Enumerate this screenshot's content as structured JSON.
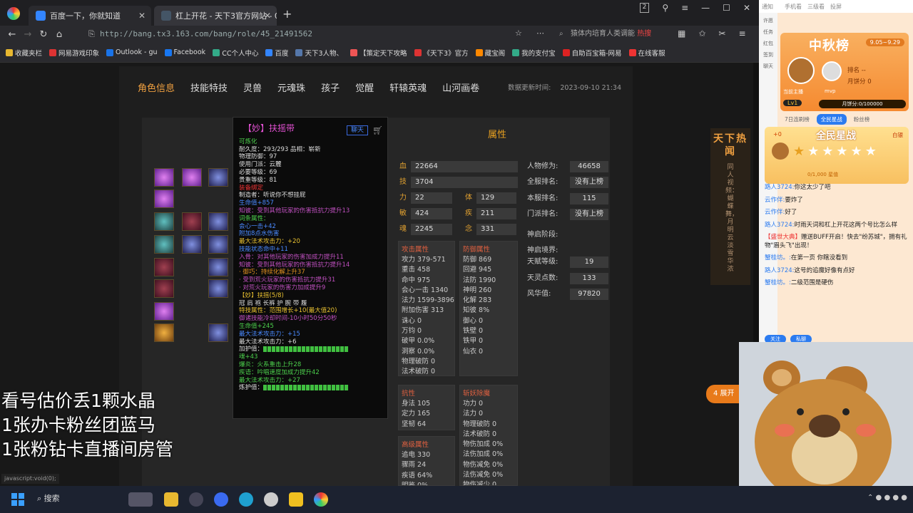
{
  "browser": {
    "tab1": "百度一下，你就知道",
    "tab2": "杠上开花 - 天下3官方网站 - 0",
    "url": "http://bang.tx3.163.com/bang/role/45_21491562",
    "search": "猿体内培育人类调能",
    "search_hot": "热搜",
    "badge_count": "2"
  },
  "bookmarks": [
    "收藏夹栏",
    "网易游戏印象",
    "Outlook - gu",
    "Facebook",
    "CC个人中心",
    "百度",
    "天下3人物、",
    "【策定天下攻略",
    "《天下3》官方",
    "藏宝阁",
    "我的支付宝",
    "自助百宝箱-网易",
    "在线客服"
  ],
  "game": {
    "tabs": [
      "角色信息",
      "技能特技",
      "灵兽",
      "元魂珠",
      "孩子",
      "觉醒",
      "轩辕英魂",
      "山河画卷"
    ],
    "active_tab": 0,
    "updated_label": "数据更新时间:",
    "updated_time": "2023-09-10 21:34",
    "attr_title": "属性",
    "stats_left": [
      {
        "k": "血",
        "v": "22664"
      },
      {
        "k": "技",
        "v": "3704"
      }
    ],
    "stats_pairs": [
      {
        "k1": "力",
        "v1": "22",
        "k2": "体",
        "v2": "129"
      },
      {
        "k1": "敏",
        "v1": "424",
        "k2": "疾",
        "v2": "211"
      },
      {
        "k1": "魂",
        "v1": "2245",
        "k2": "念",
        "v2": "331"
      }
    ],
    "stats_right": [
      {
        "k": "人物修为:",
        "v": "46658"
      },
      {
        "k": "全服排名:",
        "v": "没有上榜"
      },
      {
        "k": "本服排名:",
        "v": "115"
      },
      {
        "k": "门派排名:",
        "v": "没有上榜"
      },
      {
        "k": "神启阶段:",
        "v": ""
      },
      {
        "k": "神启境界:",
        "v": ""
      },
      {
        "k": "天赋等级:",
        "v": "19"
      },
      {
        "k": "天灵点数:",
        "v": "133"
      },
      {
        "k": "风华值:",
        "v": "97820"
      }
    ],
    "attack": {
      "title": "攻击属性",
      "rows": [
        "攻力 379-571",
        "重击 458",
        "命中 975",
        "会心一击 1340",
        "法力 1599-3896",
        "附加伤害 313",
        "诛心 0",
        "万钧 0",
        "破甲 0.0%",
        "洞察 0.0%",
        "物理破防 0",
        "法术破防 0"
      ]
    },
    "defense": {
      "title": "防御属性",
      "rows": [
        "防御 869",
        "回避 945",
        "法防 1990",
        "神明 260",
        "化解 283",
        "知彼 8%",
        "御心 0",
        "铁壁 0",
        "铁甲 0",
        "仙衣 0"
      ]
    },
    "resist": {
      "title": "抗性",
      "rows": [
        "身法 105",
        "定力 165",
        "坚韧 64"
      ]
    },
    "adv": {
      "title": "高级属性",
      "rows": [
        "追电 330",
        "骤雨 24",
        "疾语 64%",
        "明鉴 0%"
      ]
    },
    "special": {
      "title": "斩妖除魔",
      "rows": [
        "功力 0",
        "法力 0",
        "物理破防 0",
        "法术破防 0",
        "物伤加成 0%",
        "法伤加成 0%",
        "物伤减免 0%",
        "法伤减免 0%",
        "物伤减少 0"
      ]
    }
  },
  "tooltip": {
    "title": "【妙】扶摇带",
    "button": "聊天",
    "lines": [
      {
        "c": "g",
        "t": "可炼化"
      },
      {
        "c": "w",
        "t": "耐久度：293/293        品相：崭新"
      },
      {
        "c": "w",
        "t": "物理防御：97"
      },
      {
        "c": "w",
        "t": "使用门派：云麓"
      },
      {
        "c": "w",
        "t": "必要等级：69"
      },
      {
        "c": "w",
        "t": "贵重等级：81"
      },
      {
        "c": "r",
        "t": "装备绑定"
      },
      {
        "c": "w",
        "t": "制造者：听说你不想挂屁"
      },
      {
        "c": "b",
        "t": "生命值+857"
      },
      {
        "c": "p",
        "t": "知彼：受到其他玩家的伤害抵抗力提升13"
      },
      {
        "c": "g",
        "t": "词条属性："
      },
      {
        "c": "b",
        "t": "会心一击+42"
      },
      {
        "c": "b",
        "t": "附加8点水伤害"
      },
      {
        "c": "y",
        "t": "最大法术攻击力：+20"
      },
      {
        "c": "b",
        "t": "技能状态命中+11"
      },
      {
        "c": "p",
        "t": "入骨：对其他玩家的伤害加成力提升11"
      },
      {
        "c": "p",
        "t": "知彼：受到其他玩家的伤害抵抗力提升14"
      },
      {
        "c": "o",
        "t": " · 御巧：持续化解上升37"
      },
      {
        "c": "p",
        "t": " · 受到荒火玩家的伤害抵抗力提升31"
      },
      {
        "c": "p",
        "t": " · 对荒火玩家的伤害力加成提升9"
      },
      {
        "c": "y",
        "t": "【妙】扶摇(5/8)"
      },
      {
        "c": "w",
        "t": "      冠  肩  袍  长裤  护  腕  带  履"
      },
      {
        "c": "y",
        "t": "      特技属性：范围增长+10(最大值20)"
      },
      {
        "c": "p",
        "t": "御诸技能冷却时间-10小时50分50秒"
      },
      {
        "c": "g",
        "t": "生命值+245"
      },
      {
        "c": "b",
        "t": "最大法术攻击力：+15"
      },
      {
        "c": "w",
        "t": "最大法术攻击力：+6"
      },
      {
        "c": "w",
        "t": ""
      },
      {
        "c": "w",
        "t": "加护值："
      },
      {
        "c": "g",
        "t": "魂+43"
      },
      {
        "c": "g",
        "t": "爆炎：火系重击上升28"
      },
      {
        "c": "g",
        "t": "疾语：吟唱速度加成力提升42"
      },
      {
        "c": "g",
        "t": "最大法术攻击力：+27"
      },
      {
        "c": "w",
        "t": ""
      },
      {
        "c": "w",
        "t": "炼护值："
      }
    ]
  },
  "news": {
    "title": "天下热闻",
    "side": "同人视频：蝴蝶舞，月明云淡雪华浓"
  },
  "orange_tab": "4 展开",
  "overlay": [
    "看号估价丢1颗水晶",
    "1张办卡粉丝团蓝马",
    "1张粉钻卡直播间房管"
  ],
  "status_url": "javascript:void(0);",
  "taskbar": {
    "search": "搜索"
  },
  "stream": {
    "topbar": [
      "通知",
      "手机看",
      "三级看",
      "投屏"
    ],
    "sidebar": [
      "许愿",
      "任务",
      "红包",
      "签到",
      "聊天"
    ],
    "festival_title": "中秋榜",
    "festival_date": "9.05~9.29",
    "rank_label": "排名",
    "rank_value": "--",
    "cake_label": "月饼分",
    "cake_value": "0",
    "host_label": "当前主播",
    "mvp_label": "mvp",
    "level": "Lv1",
    "cake_progress": "月饼分:0/100000",
    "tabs": [
      "7日连刷榜",
      "全民星战",
      "粉丝榜"
    ],
    "star_plus": "+0",
    "star_title": "全民星战",
    "star_label": "白银",
    "star_progress": "0/1,000 星值",
    "chat": [
      {
        "n": "路人3724:",
        "t": "你这太少了吧"
      },
      {
        "n": "云作伴:",
        "t": "要炸了"
      },
      {
        "n": "云作伴:",
        "t": "好了"
      },
      {
        "n": "路人3724:",
        "t": "时雨天词和杠上开花这两个号比怎么样"
      },
      {
        "n": "【盛世大典】",
        "t": "赠送BUFF开启！快去\"纷苏城\"，拥有礼物\"眉头飞\"出现！"
      },
      {
        "n": "蟹桂坊。:",
        "t": "在第一页 你瞎没看到"
      },
      {
        "n": "路人3724:",
        "t": "这号的追魔好像有点好"
      },
      {
        "n": "蟹桂坊。:",
        "t": "二级范围是硬伤"
      }
    ],
    "chat_buttons": [
      "关注",
      "私聊"
    ]
  }
}
